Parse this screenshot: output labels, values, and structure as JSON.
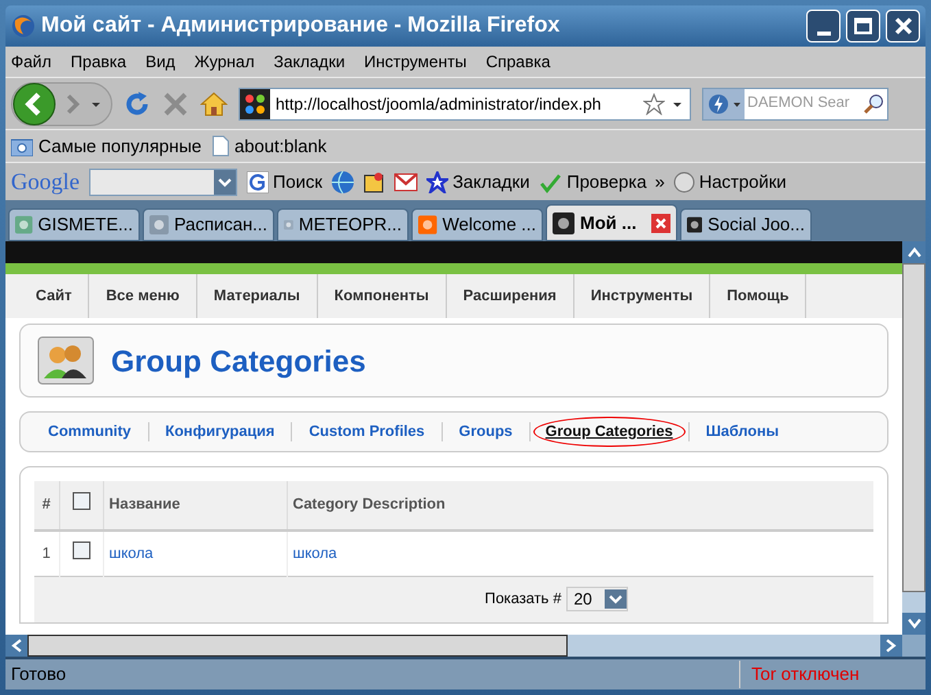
{
  "window": {
    "title": "Мой сайт - Администрирование - Mozilla Firefox"
  },
  "menu_bar": [
    "Файл",
    "Правка",
    "Вид",
    "Журнал",
    "Закладки",
    "Инструменты",
    "Справка"
  ],
  "address_bar": {
    "value": "http://localhost/joomla/administrator/index.ph"
  },
  "search_bar": {
    "placeholder": "DAEMON Sear"
  },
  "bookmarks": [
    {
      "kind": "folder",
      "label": "Самые популярные"
    },
    {
      "kind": "page",
      "label": "about:blank"
    }
  ],
  "google_toolbar": {
    "logo": "Google",
    "items": [
      "Поиск",
      "Закладки",
      "Проверка",
      "»",
      "Настройки"
    ]
  },
  "tabs": [
    {
      "label": "GISMETE...",
      "selected": false
    },
    {
      "label": "Расписан...",
      "selected": false
    },
    {
      "label": "METEOPR...",
      "selected": false
    },
    {
      "label": "Welcome ...",
      "selected": false
    },
    {
      "label": "Мой ...",
      "selected": true
    },
    {
      "label": "Social Joo...",
      "selected": false
    }
  ],
  "admin_menu": [
    "Сайт",
    "Все меню",
    "Материалы",
    "Компоненты",
    "Расширения",
    "Инструменты",
    "Помощь"
  ],
  "page_title": "Group Categories",
  "submenu": [
    {
      "label": "Community",
      "selected": false
    },
    {
      "label": "Конфигурация",
      "selected": false
    },
    {
      "label": "Custom Profiles",
      "selected": false
    },
    {
      "label": "Groups",
      "selected": false
    },
    {
      "label": "Group Categories",
      "selected": true
    },
    {
      "label": "Шаблоны",
      "selected": false
    }
  ],
  "table": {
    "columns": [
      "#",
      "Название",
      "Category Description"
    ],
    "rows": [
      {
        "cells": [
          "1",
          "школа",
          "школа"
        ],
        "checked": false
      }
    ],
    "header_checked": false,
    "footer": {
      "label": "Показать #",
      "value": "20"
    }
  },
  "status_bar": {
    "text": "Готово",
    "tor": "Tor отключен"
  }
}
